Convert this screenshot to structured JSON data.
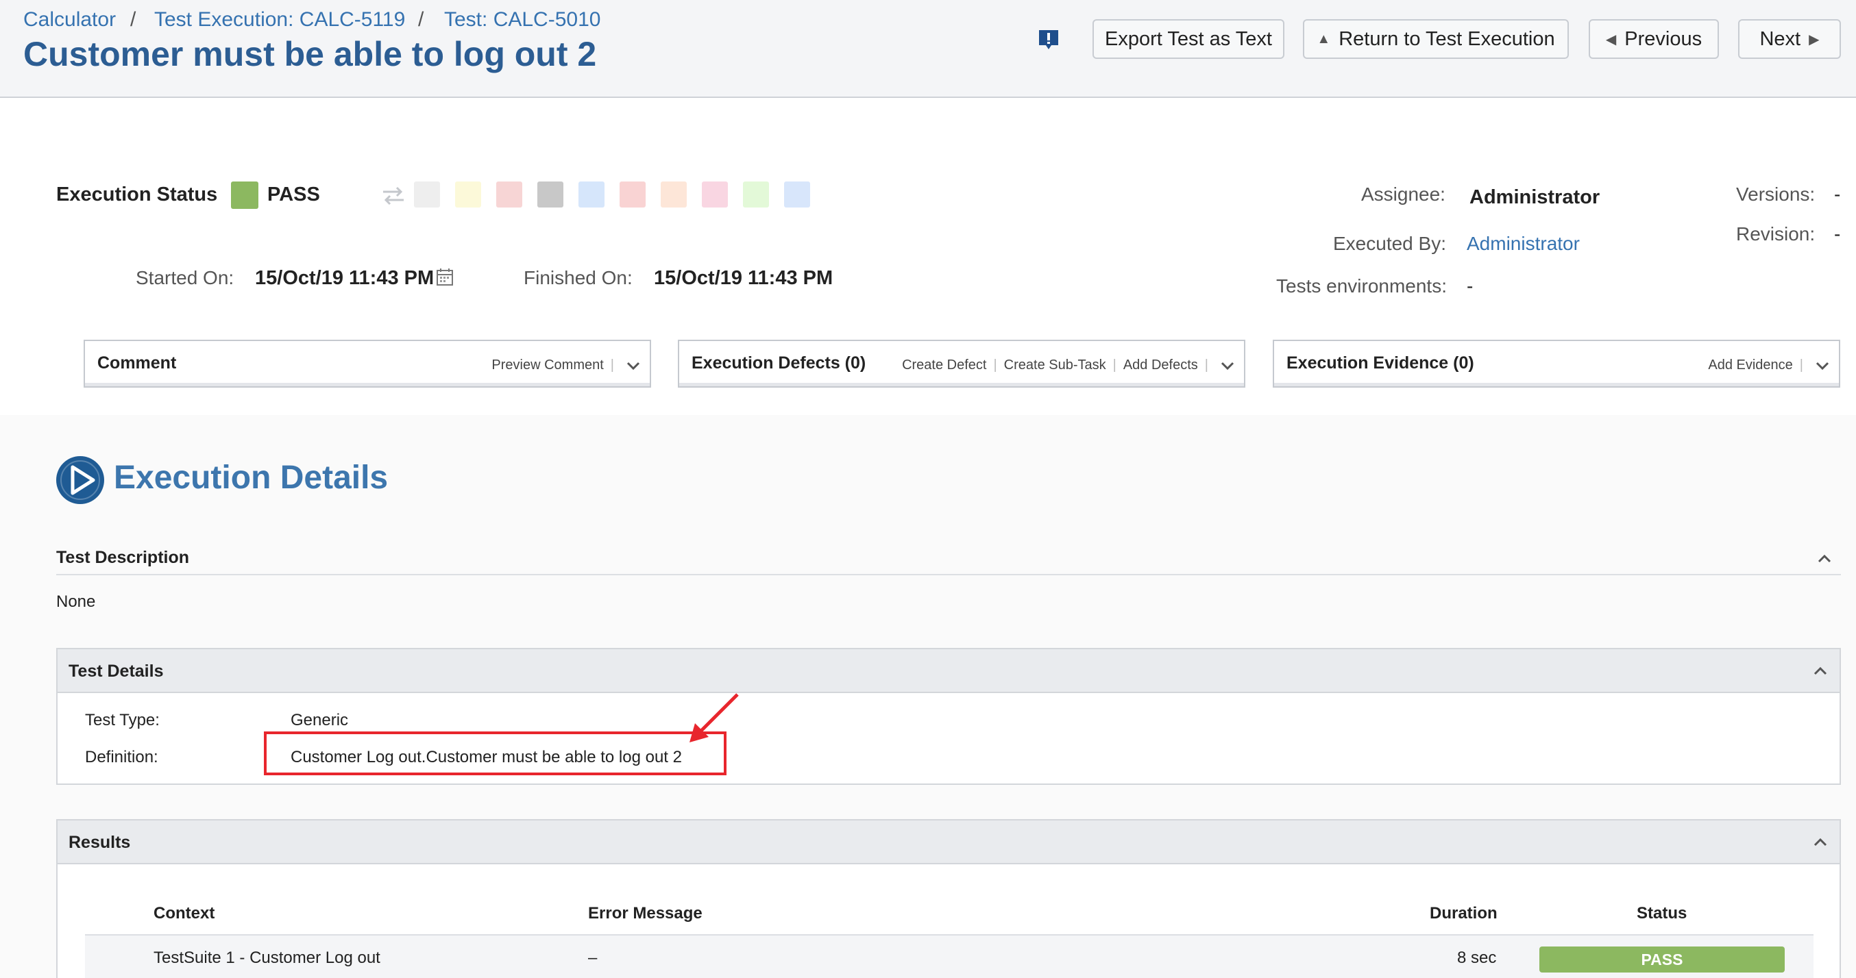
{
  "breadcrumb": {
    "items": [
      "Calculator",
      "Test Execution: CALC-5119",
      "Test: CALC-5010"
    ],
    "separator": "/"
  },
  "page_title": "Customer must be able to log out 2",
  "header_buttons": {
    "feedback_icon": "exclamation-speech-icon",
    "export": "Export Test as Text",
    "return": "Return to Test Execution",
    "previous": "Previous",
    "next": "Next"
  },
  "execution": {
    "status_label": "Execution Status",
    "status_value": "PASS",
    "status_color": "#8cb860",
    "palette_colors": [
      "#eeeeee",
      "#fcf9d9",
      "#f7d5d5",
      "#c8c8c8",
      "#d6e6fb",
      "#f9d3d3",
      "#fde6d8",
      "#f9d6e2",
      "#e3f9d8",
      "#d8e6fb"
    ],
    "started_label": "Started On:",
    "started_value": "15/Oct/19 11:43 PM",
    "finished_label": "Finished On:",
    "finished_value": "15/Oct/19 11:43 PM",
    "assignee_label": "Assignee:",
    "assignee_value": "Administrator",
    "executed_by_label": "Executed By:",
    "executed_by_value": "Administrator",
    "environments_label": "Tests environments:",
    "environments_value": "-",
    "versions_label": "Versions:",
    "versions_value": "-",
    "revision_label": "Revision:",
    "revision_value": "-"
  },
  "panels": {
    "comment": {
      "title": "Comment",
      "links": [
        "Preview Comment"
      ]
    },
    "defects": {
      "title": "Execution Defects (0)",
      "links": [
        "Create Defect",
        "Create Sub-Task",
        "Add Defects"
      ]
    },
    "evidence": {
      "title": "Execution Evidence (0)",
      "links": [
        "Add Evidence"
      ]
    }
  },
  "details": {
    "heading": "Execution Details",
    "description_title": "Test Description",
    "description_value": "None",
    "test_details_title": "Test Details",
    "test_type_label": "Test Type:",
    "test_type_value": "Generic",
    "definition_label": "Definition:",
    "definition_value": "Customer Log out.Customer must be able to log out 2",
    "results_title": "Results",
    "results_columns": [
      "Context",
      "Error Message",
      "Duration",
      "Status"
    ],
    "results_rows": [
      {
        "context": "TestSuite 1 - Customer Log out",
        "error": "–",
        "duration": "8 sec",
        "status": "PASS"
      }
    ]
  },
  "colors": {
    "link": "#3572b0",
    "highlight_annotation": "#e8262d",
    "pass": "#8cb860"
  }
}
